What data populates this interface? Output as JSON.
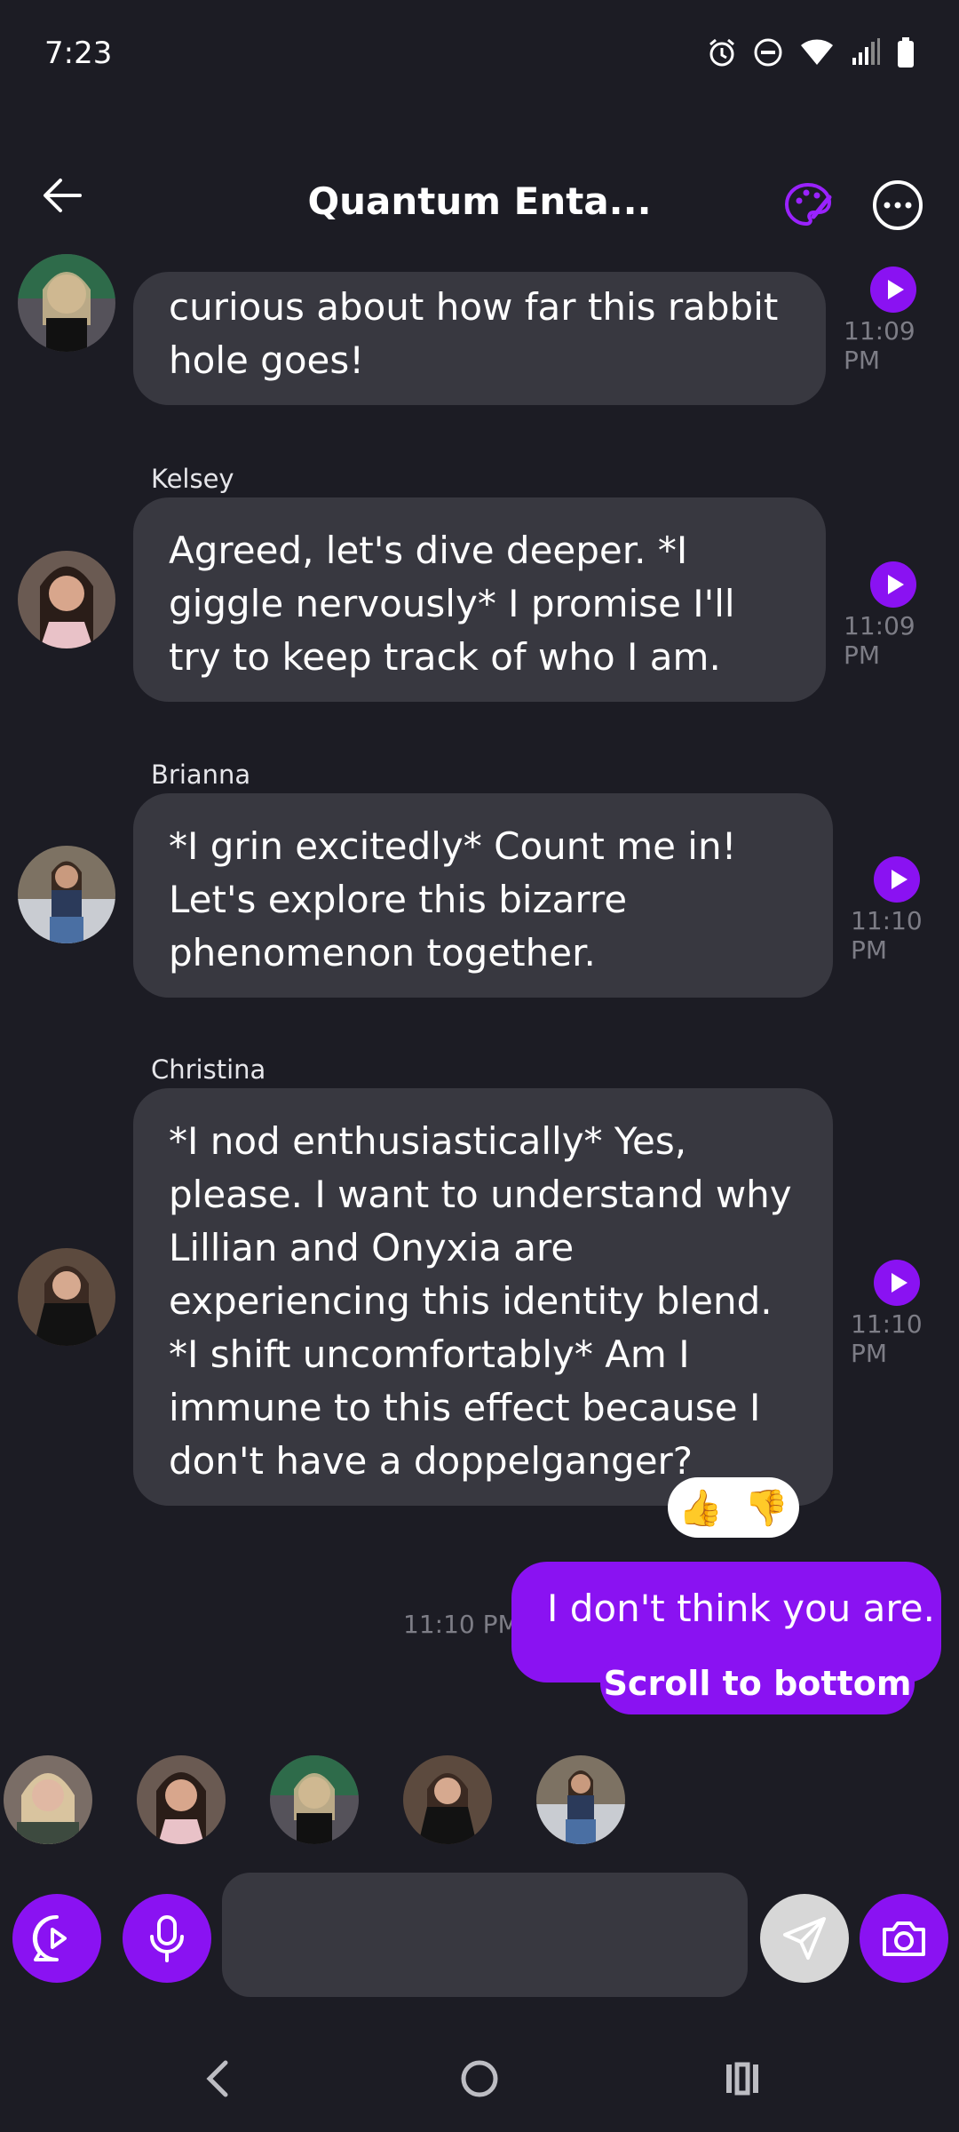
{
  "status": {
    "time": "7:23"
  },
  "header": {
    "title": "Quantum Enta..."
  },
  "messages": [
    {
      "sender": "",
      "text": "curious about how far this rabbit hole goes!",
      "time": "11:09 PM"
    },
    {
      "sender": "Kelsey",
      "text": "Agreed, let's dive deeper. *I giggle nervously* I promise I'll try to keep track of who I am.",
      "time": "11:09 PM"
    },
    {
      "sender": "Brianna",
      "text": "*I grin excitedly* Count me in! Let's explore this bizarre phenomenon together.",
      "time": "11:10 PM"
    },
    {
      "sender": "Christina",
      "text": "*I nod enthusiastically* Yes, please. I want to understand why Lillian and Onyxia are experiencing this identity blend. *I shift uncomfortably* Am I immune to this effect because I don't have a doppelganger?",
      "time": "11:10 PM"
    }
  ],
  "reactions": {
    "up": "👍",
    "down": "👎"
  },
  "user_message": {
    "text": "I don't think you are.",
    "time": "11:10 PM"
  },
  "scroll_to_bottom": "Scroll to bottom",
  "composer": {
    "placeholder": ""
  },
  "colors": {
    "accent": "#8a12f2",
    "background": "#1c1c24",
    "bubble": "#383840"
  }
}
